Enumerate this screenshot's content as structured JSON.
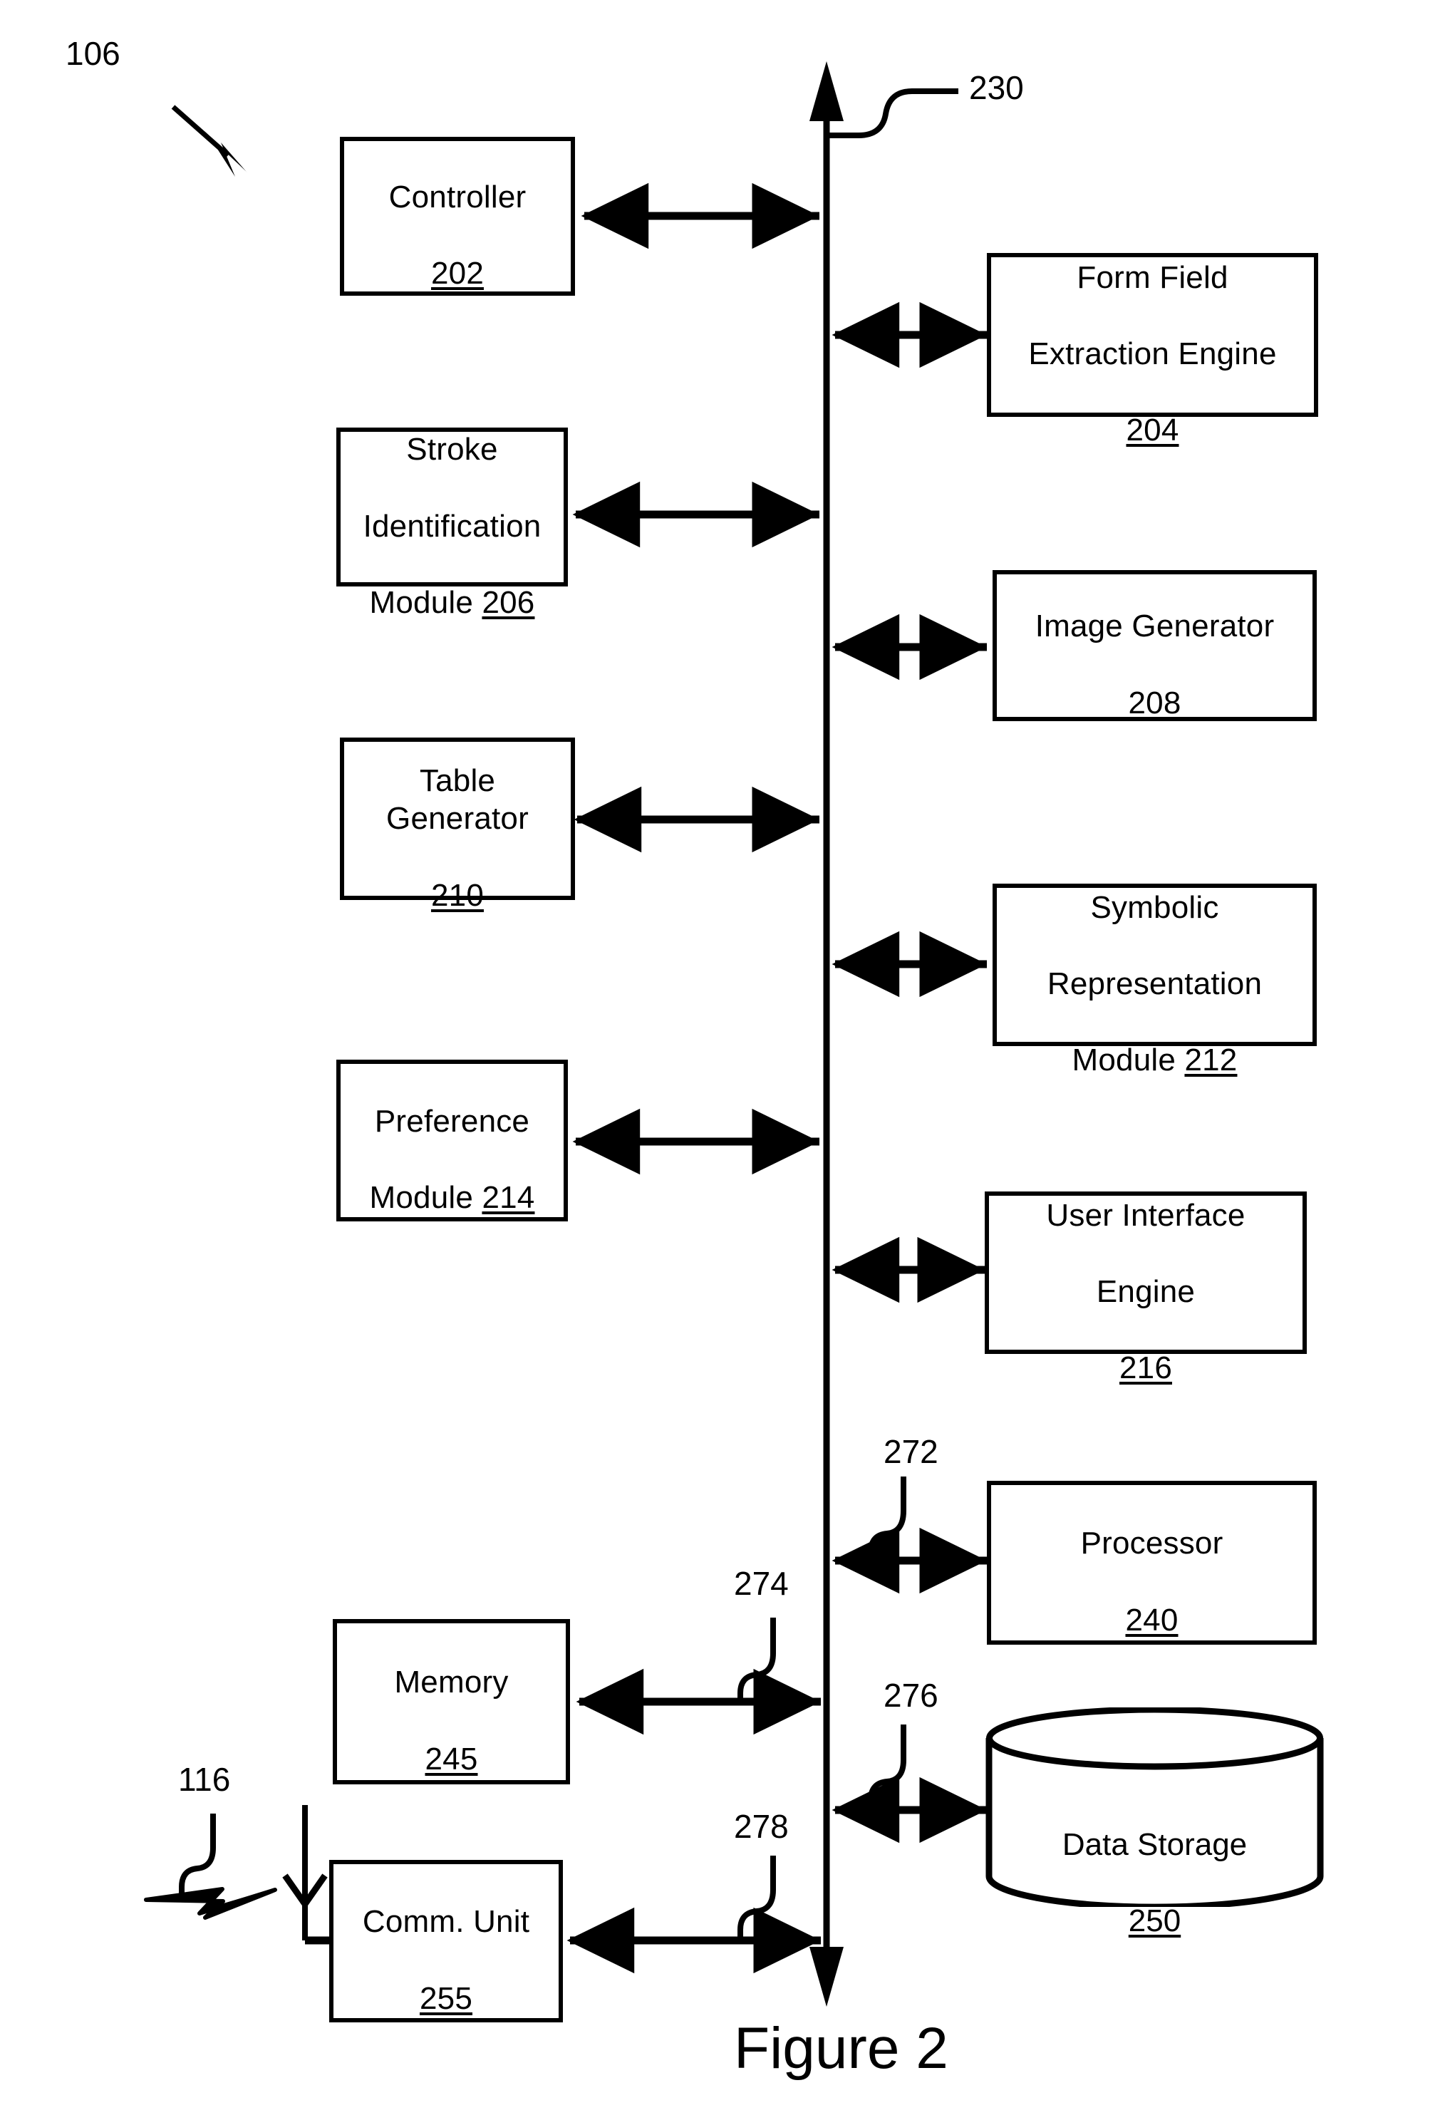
{
  "figure": {
    "caption": "Figure 2",
    "system_ref": "106",
    "bus_ref": "230",
    "signal_ref": "116"
  },
  "colors": {
    "ink": "#000000",
    "paper": "#ffffff"
  },
  "bus": {
    "name": "bus",
    "label": "230"
  },
  "blocks": [
    {
      "id": "controller",
      "name": "Controller",
      "title": "Controller",
      "ref": "202",
      "layout": "two-line",
      "side": "left"
    },
    {
      "id": "form-field-extraction",
      "name": "Form Field Extraction Engine",
      "title": "Form Field\nExtraction Engine",
      "ref": "204",
      "layout": "two-line",
      "side": "right"
    },
    {
      "id": "stroke-identification",
      "name": "Stroke Identification Module",
      "title": "Stroke\nIdentification\nModule",
      "ref": "206",
      "layout": "inline",
      "side": "left"
    },
    {
      "id": "image-generator",
      "name": "Image Generator",
      "title": "Image Generator",
      "ref": "208",
      "layout": "two-line",
      "side": "right"
    },
    {
      "id": "table-generator",
      "name": "Table Generator",
      "title": "Table Generator",
      "ref": "210",
      "layout": "two-line",
      "side": "left"
    },
    {
      "id": "symbolic-representation",
      "name": "Symbolic Representation Module",
      "title": "Symbolic\nRepresentation\nModule",
      "ref": "212",
      "layout": "inline",
      "side": "right"
    },
    {
      "id": "preference-module",
      "name": "Preference Module",
      "title": "Preference\nModule",
      "ref": "214",
      "layout": "inline",
      "side": "left"
    },
    {
      "id": "user-interface-engine",
      "name": "User Interface Engine",
      "title": "User Interface\nEngine",
      "ref": "216",
      "layout": "two-line",
      "side": "right"
    },
    {
      "id": "processor",
      "name": "Processor",
      "title": "Processor",
      "ref": "240",
      "layout": "two-line",
      "side": "right"
    },
    {
      "id": "memory",
      "name": "Memory",
      "title": "Memory",
      "ref": "245",
      "layout": "two-line",
      "side": "left"
    },
    {
      "id": "data-storage",
      "name": "Data Storage",
      "title": "Data Storage",
      "ref": "250",
      "layout": "two-line",
      "side": "right",
      "shape": "cylinder"
    },
    {
      "id": "comm-unit",
      "name": "Comm. Unit",
      "title": "Comm. Unit",
      "ref": "255",
      "layout": "two-line",
      "side": "left"
    }
  ],
  "block_text": {
    "controller": {
      "title": "Controller",
      "ref": "202"
    },
    "form_field_extraction": {
      "line1": "Form Field",
      "line2": "Extraction Engine",
      "ref": "204"
    },
    "stroke_identification": {
      "line1": "Stroke",
      "line2": "Identification",
      "line3": "Module ",
      "ref": "206"
    },
    "image_generator": {
      "title": "Image Generator",
      "ref": "208"
    },
    "table_generator": {
      "title": "Table Generator",
      "ref": "210"
    },
    "symbolic_representation": {
      "line1": "Symbolic",
      "line2": "Representation",
      "line3": "Module ",
      "ref": "212"
    },
    "preference_module": {
      "line1": "Preference",
      "line2": "Module ",
      "ref": "214"
    },
    "user_interface_engine": {
      "line1": "User Interface",
      "line2": "Engine",
      "ref": "216"
    },
    "processor": {
      "title": "Processor",
      "ref": "240"
    },
    "memory": {
      "title": "Memory",
      "ref": "245"
    },
    "data_storage": {
      "title": "Data Storage",
      "ref": "250"
    },
    "comm_unit": {
      "title": "Comm. Unit",
      "ref": "255"
    }
  },
  "connector_labels": {
    "processor_link": "272",
    "memory_link": "274",
    "data_storage_link": "276",
    "comm_unit_link": "278"
  },
  "annotations": {
    "system": "106",
    "bus": "230",
    "wireless_signal": "116"
  }
}
